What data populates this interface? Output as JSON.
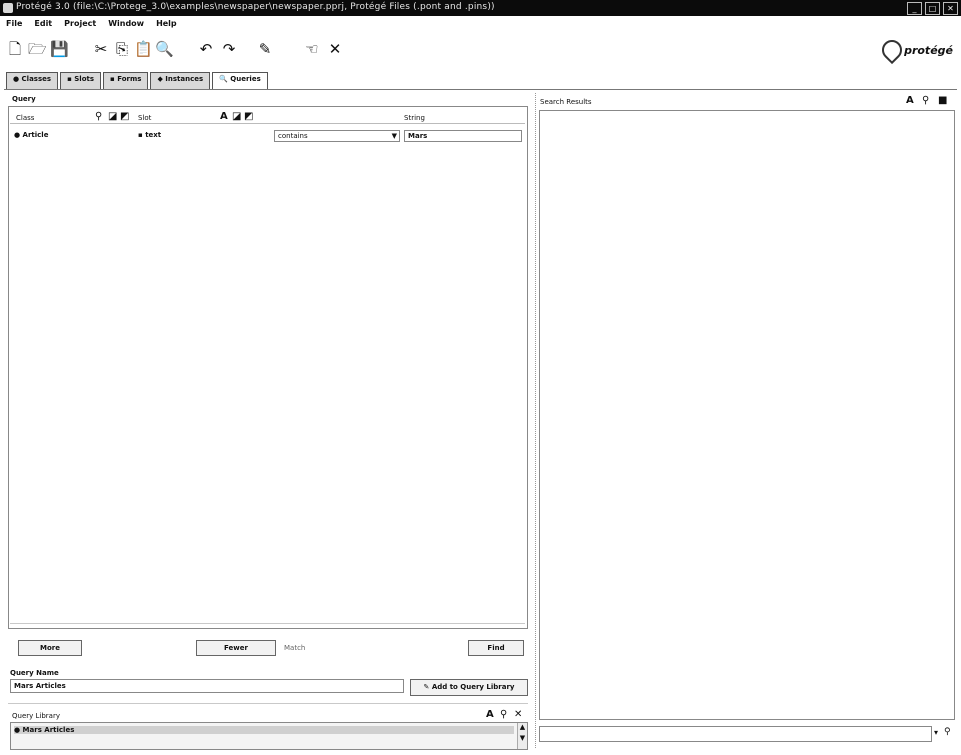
{
  "window": {
    "title": "Protégé 3.0   (file:\\C:\\Protege_3.0\\examples\\newspaper\\newspaper.pprj, Protégé Files (.pont and .pins))",
    "controls": [
      "_",
      "□",
      "✕"
    ]
  },
  "menu": [
    "File",
    "Edit",
    "Project",
    "Window",
    "Help"
  ],
  "toolbar": {
    "icons": [
      "new-icon",
      "open-icon",
      "save-icon",
      "cut-icon",
      "copy-icon",
      "paste-icon",
      "find-icon",
      "undo-icon",
      "redo-icon",
      "configure-icon",
      "close-icon"
    ],
    "glyphs": [
      "🗋",
      "🗁",
      "💾",
      "✂",
      "⎘",
      "📋",
      "🔍",
      "✎",
      "↶",
      "↷",
      "✕"
    ],
    "logo": "protégé"
  },
  "tabs": [
    {
      "label": "Classes",
      "icon": "●"
    },
    {
      "label": "Slots",
      "icon": "▪"
    },
    {
      "label": "Forms",
      "icon": "▪"
    },
    {
      "label": "Instances",
      "icon": "◆"
    },
    {
      "label": "Queries",
      "icon": "🔍"
    }
  ],
  "query": {
    "label": "Query",
    "columns": {
      "class": "Class",
      "slot": "Slot",
      "string": "String"
    },
    "row": {
      "class": "Article",
      "slot": "text",
      "operator": "contains",
      "value": "Mars"
    },
    "more_button": "More",
    "fewer_button": "Fewer",
    "match_label": "Match",
    "find_button": "Find"
  },
  "query_name": {
    "label": "Query Name",
    "value": "Mars Articles",
    "add_button": "Add to Query Library"
  },
  "query_library": {
    "label": "Query Library",
    "items": [
      "Mars Articles"
    ]
  },
  "search_results": {
    "label": "Search Results"
  }
}
